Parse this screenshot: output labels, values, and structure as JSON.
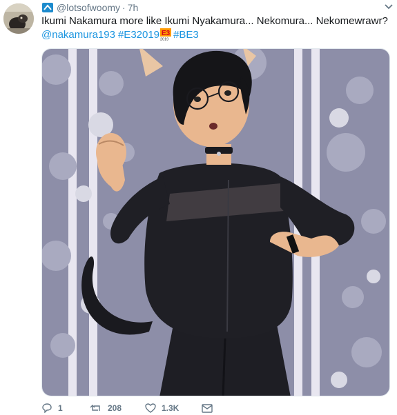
{
  "tweet": {
    "username": "@lotsofwoomy",
    "separator": "·",
    "time": "7h",
    "text": "Ikumi Nakamura more like Ikumi Nyakamura... Nekomura... Nekomewrawr?",
    "mention": "@nakamura193",
    "hashtag1": "#E32019",
    "hashtag2": "#BE3",
    "e3_logo_text": "E3",
    "e3_logo_year": "2019"
  },
  "actions": {
    "reply_count": "1",
    "retweet_count": "208",
    "like_count": "1.3K"
  },
  "colors": {
    "link": "#1b95e0",
    "meta": "#657786",
    "text": "#14171a",
    "background_purple": "#8d8ea8"
  },
  "icons": [
    "avatar",
    "badge-icon",
    "chevron-down-icon",
    "reply-icon",
    "retweet-icon",
    "like-icon",
    "dm-icon"
  ]
}
